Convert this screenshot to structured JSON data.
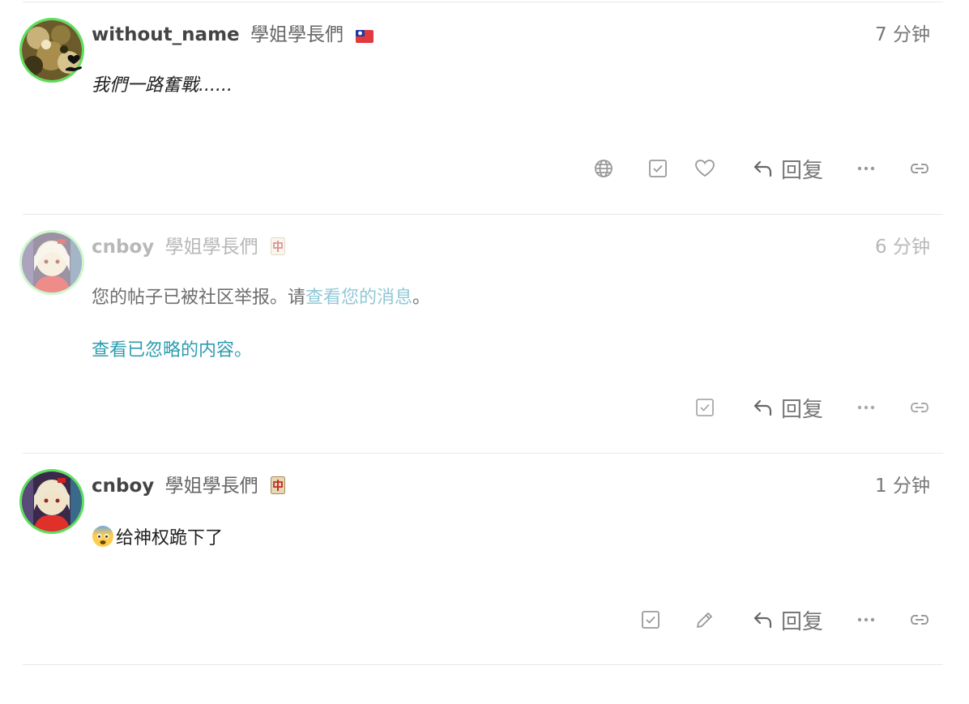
{
  "posts": [
    {
      "username": "without_name",
      "user_title": "學姐學長們",
      "flair": "taiwan-flag-icon",
      "time": "7 分钟",
      "body": "我們一路奮戰......",
      "actions": [
        "globe-icon",
        "check-box-icon",
        "heart-icon",
        "reply-icon",
        "more-icon",
        "link-icon"
      ],
      "reply_label": "回复"
    },
    {
      "username": "cnboy",
      "user_title": "學姐學長們",
      "flair": "mahjong-red-dragon-icon",
      "time": "6 分钟",
      "flag_notice_prefix": "您的帖子已被社区举报。请",
      "flag_notice_link": "查看您的消息",
      "flag_notice_suffix": "。",
      "ignored_link": "查看已忽略的内容。",
      "actions": [
        "check-box-icon",
        "reply-icon",
        "more-icon",
        "link-icon"
      ],
      "reply_label": "回复"
    },
    {
      "username": "cnboy",
      "user_title": "學姐學長們",
      "flair": "mahjong-red-dragon-icon",
      "time": "1 分钟",
      "emoji": "fearful-face-emoji",
      "body": "给神权跪下了",
      "actions": [
        "check-box-icon",
        "pencil-icon",
        "reply-icon",
        "more-icon",
        "link-icon"
      ],
      "reply_label": "回复"
    }
  ],
  "colors": {
    "avatar_ring": "#5be05b",
    "link": "#2e9db0",
    "link_faded": "#8fc8d6",
    "divider": "#e9e9e9"
  }
}
